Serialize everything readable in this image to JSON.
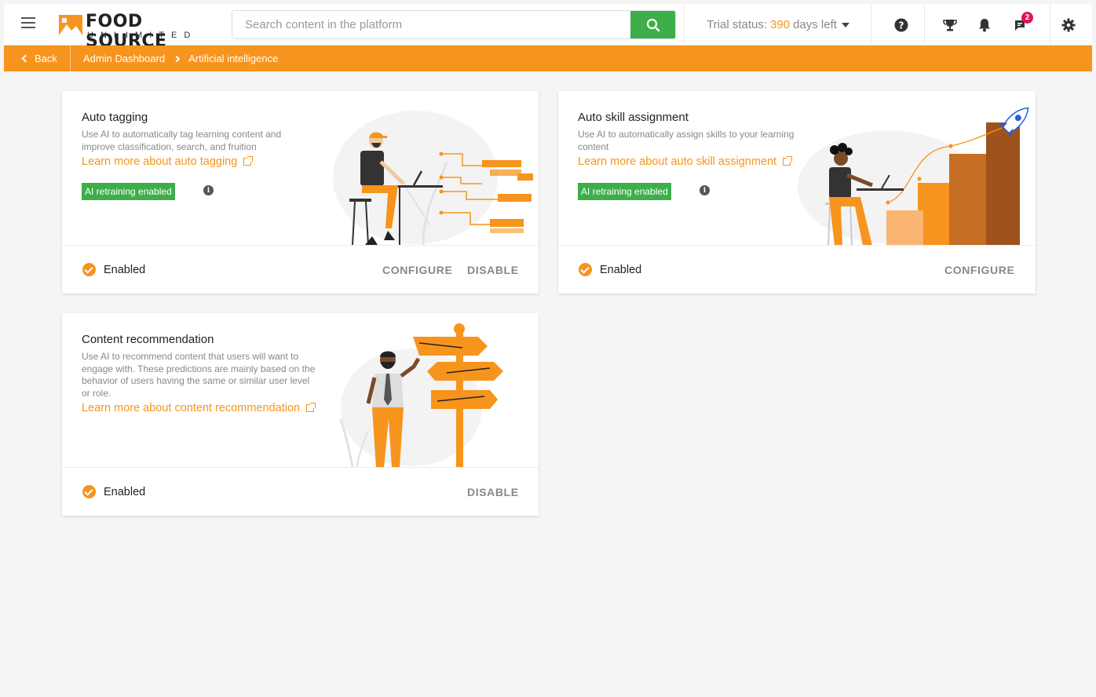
{
  "header": {
    "logo_line1": "FOOD SOURCE",
    "logo_line2": "UNLIMITED",
    "search_placeholder": "Search content in the platform",
    "trial_prefix": "Trial status:",
    "trial_days": "390",
    "trial_suffix": "days left",
    "messages_badge": "2"
  },
  "nav": {
    "back_label": "Back",
    "breadcrumb": [
      "Admin Dashboard",
      "Artificial intelligence"
    ]
  },
  "cards": [
    {
      "title": "Auto tagging",
      "description_lines": [
        "Use AI to automatically tag learning content and",
        "improve classification, search, and fruition"
      ],
      "learn_more": "Learn more about auto tagging",
      "badge": "AI retraining enabled",
      "status": "Enabled",
      "actions": [
        "CONFIGURE",
        "DISABLE"
      ]
    },
    {
      "title": "Auto skill assignment",
      "description_lines": [
        "Use AI to automatically assign skills to your learning",
        "content"
      ],
      "learn_more": "Learn more about auto skill assignment",
      "badge": "AI retraining enabled",
      "status": "Enabled",
      "actions": [
        "CONFIGURE"
      ]
    },
    {
      "title": "Content recommendation",
      "description_lines": [
        "Use AI to recommend content that users will want to",
        "engage with. These predictions are mainly based on the",
        "behavior of users having the same or similar user level",
        "or role."
      ],
      "learn_more": "Learn more about content recommendation",
      "status": "Enabled",
      "actions": [
        "DISABLE"
      ]
    }
  ],
  "colors": {
    "brand_orange": "#f7941d",
    "search_green": "#3dae49",
    "badge_pink": "#e0115f"
  }
}
